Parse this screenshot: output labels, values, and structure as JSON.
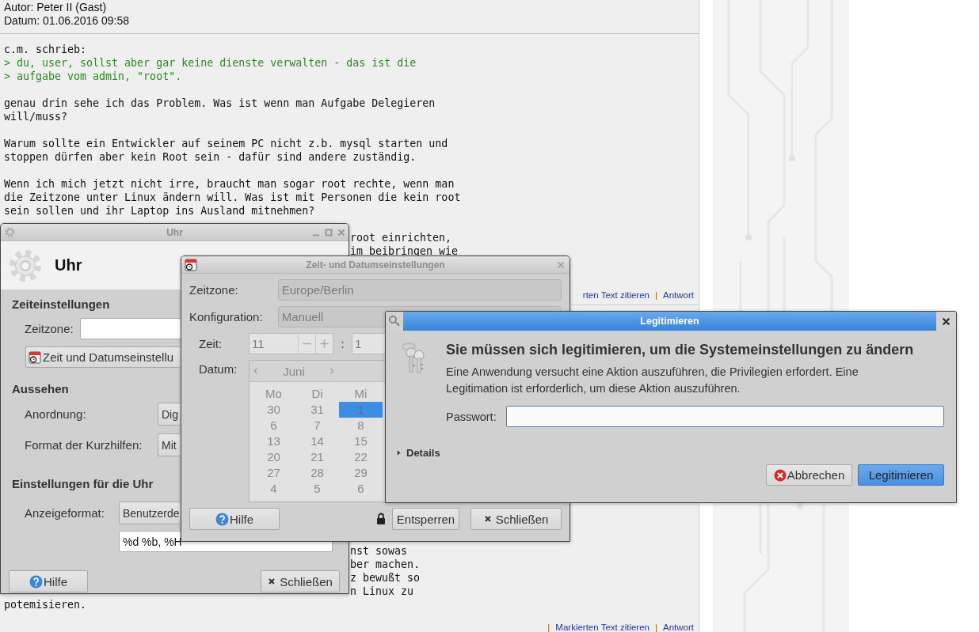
{
  "post1": {
    "author": "Autor: Peter II (Gast)",
    "date": "Datum: 01.06.2016 09:58",
    "paragraphs": [
      [
        {
          "kind": "plain",
          "text": "c.m. schrieb:"
        },
        {
          "kind": "quote",
          "text": "> du, user, sollst aber gar keine dienste verwalten - das ist die"
        },
        {
          "kind": "quote",
          "text": "> aufgabe vom admin, \"root\"."
        }
      ],
      [
        {
          "kind": "plain",
          "text": "genau drin sehe ich das Problem. Was ist wenn man Aufgabe Delegieren"
        },
        {
          "kind": "plain",
          "text": "will/muss?"
        }
      ],
      [
        {
          "kind": "plain",
          "text": "Warum sollte ein Entwickler auf seinem PC nicht z.b. mysql starten und"
        },
        {
          "kind": "plain",
          "text": "stoppen dürfen aber kein Root sein - dafür sind andere zuständig."
        }
      ],
      [
        {
          "kind": "plain",
          "text": "Wenn ich mich jetzt nicht irre, braucht man sogar root rechte, wenn man"
        },
        {
          "kind": "plain",
          "text": "die Zeitzone unter Linux ändern will. Was ist mit Personen die kein root"
        },
        {
          "kind": "plain",
          "text": "sein sollen und ihr Laptop ins Ausland mitnehmen?"
        }
      ]
    ],
    "fragments": [
      "root einrichten,",
      "im beibringen wie"
    ],
    "links": [
      {
        "kind": "link",
        "text": "rten Text zitieren"
      },
      {
        "kind": "separator",
        "text": "|"
      },
      {
        "kind": "link",
        "text": "Antwort"
      }
    ]
  },
  "post2": {
    "fragments": [
      "nst sowas",
      "ber machen.",
      "z bewußt so",
      "n Linux zu"
    ],
    "last_line": "potemisieren.",
    "links": [
      {
        "kind": "separator",
        "text": "|"
      },
      {
        "kind": "link",
        "text": "Markierten Text zitieren"
      },
      {
        "kind": "separator",
        "text": "|"
      },
      {
        "kind": "link",
        "text": "Antwort"
      }
    ]
  },
  "uhr_window": {
    "title": "Uhr",
    "header": "Uhr",
    "time_heading": "Zeiteinstellungen",
    "timezone_label": "Zeitzone:",
    "datetime_button": "Zeit und Datumseinstellu",
    "appearance_heading": "Aussehen",
    "appearance_rows": [
      {
        "label": "Anordnung:",
        "value": "Dig"
      },
      {
        "label": "Format der Kurzhilfen:",
        "value": "Mit"
      }
    ],
    "clock_heading": "Einstellungen für die Uhr",
    "format_label": "Anzeigeformat:",
    "format_value": "Benutzerde",
    "custom_format": "%d %b, %H",
    "help": "Hilfe",
    "close": "Schließen"
  },
  "zeit_window": {
    "title": "Zeit- und Datumseinstellungen",
    "timezone_label": "Zeitzone:",
    "timezone": "Europe/Berlin",
    "config_label": "Konfiguration:",
    "config": "Manuell",
    "time_label": "Zeit:",
    "hours": "11",
    "separator": ":",
    "minutes": "1",
    "date_label": "Datum:",
    "month": "Juni",
    "weekdays": [
      "Mo",
      "Di",
      "Mi"
    ],
    "weeks": [
      [
        {
          "day": "30",
          "selected": false
        },
        {
          "day": "31",
          "selected": false
        },
        {
          "day": "1",
          "selected": true
        }
      ],
      [
        {
          "day": "6",
          "selected": false
        },
        {
          "day": "7",
          "selected": false
        },
        {
          "day": "8",
          "selected": false
        }
      ],
      [
        {
          "day": "13",
          "selected": false
        },
        {
          "day": "14",
          "selected": false
        },
        {
          "day": "15",
          "selected": false
        }
      ],
      [
        {
          "day": "20",
          "selected": false
        },
        {
          "day": "21",
          "selected": false
        },
        {
          "day": "22",
          "selected": false
        }
      ],
      [
        {
          "day": "27",
          "selected": false
        },
        {
          "day": "28",
          "selected": false
        },
        {
          "day": "29",
          "selected": false
        }
      ],
      [
        {
          "day": "4",
          "selected": false
        },
        {
          "day": "5",
          "selected": false
        },
        {
          "day": "6",
          "selected": false
        }
      ]
    ],
    "help": "Hilfe",
    "unlock": "Entsperren",
    "close": "Schließen"
  },
  "auth_dialog": {
    "title": "Legitimieren",
    "heading": "Sie müssen sich legitimieren, um die Systemeinstellungen zu ändern",
    "message": "Eine Anwendung versucht eine Aktion auszuführen, die Privilegien erfordert. Eine Legitimation ist erforderlich, um diese Aktion auszuführen.",
    "password_label": "Passwort:",
    "details": "Details",
    "details_expanded": false,
    "cancel": "Abbrechen",
    "confirm": "Legitimieren"
  }
}
